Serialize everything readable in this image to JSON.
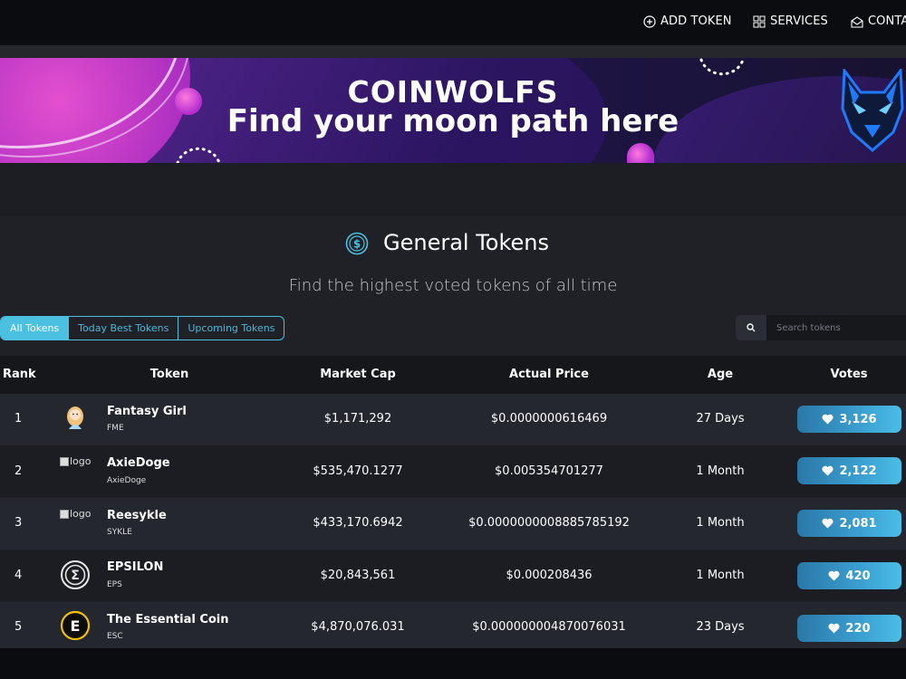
{
  "nav": {
    "add_token": "ADD TOKEN",
    "services": "SERVICES",
    "contact": "CONTA"
  },
  "banner": {
    "title": "COINWOLFS",
    "subtitle": "Find your moon path here"
  },
  "section": {
    "title": "General Tokens",
    "subtitle": "Find the highest voted tokens of all time"
  },
  "tabs": [
    {
      "label": "All Tokens",
      "active": true
    },
    {
      "label": "Today Best Tokens",
      "active": false
    },
    {
      "label": "Upcoming Tokens",
      "active": false
    }
  ],
  "search": {
    "placeholder": "Search tokens",
    "value": ""
  },
  "table": {
    "headers": {
      "rank": "Rank",
      "token": "Token",
      "market_cap": "Market Cap",
      "price": "Actual Price",
      "age": "Age",
      "votes": "Votes"
    },
    "rows": [
      {
        "rank": "1",
        "name": "Fantasy Girl",
        "symbol": "FME",
        "logo": "avatar-girl-icon",
        "market_cap": "$1,171,292",
        "price": "$0.0000000616469",
        "age": "27 Days",
        "votes": "3,126"
      },
      {
        "rank": "2",
        "name": "AxieDoge",
        "symbol": "AxieDoge",
        "logo": "broken-image",
        "logo_alt": "logo",
        "market_cap": "$535,470.1277",
        "price": "$0.005354701277",
        "age": "1 Month",
        "votes": "2,122"
      },
      {
        "rank": "3",
        "name": "Reesykle",
        "symbol": "SYKLE",
        "logo": "broken-image",
        "logo_alt": "logo",
        "market_cap": "$433,170.6942",
        "price": "$0.0000000008885785192",
        "age": "1 Month",
        "votes": "2,081"
      },
      {
        "rank": "4",
        "name": "EPSILON",
        "symbol": "EPS",
        "logo": "sigma-coin-icon",
        "market_cap": "$20,843,561",
        "price": "$0.000208436",
        "age": "1 Month",
        "votes": "420"
      },
      {
        "rank": "5",
        "name": "The Essential Coin",
        "symbol": "ESC",
        "logo": "e-coin-icon",
        "market_cap": "$4,870,076.031",
        "price": "$0.000000004870076031",
        "age": "23 Days",
        "votes": "220"
      }
    ]
  },
  "colors": {
    "accent": "#4bc0e0",
    "vote_button": "#3a9fd0",
    "background": "#1f2127"
  }
}
